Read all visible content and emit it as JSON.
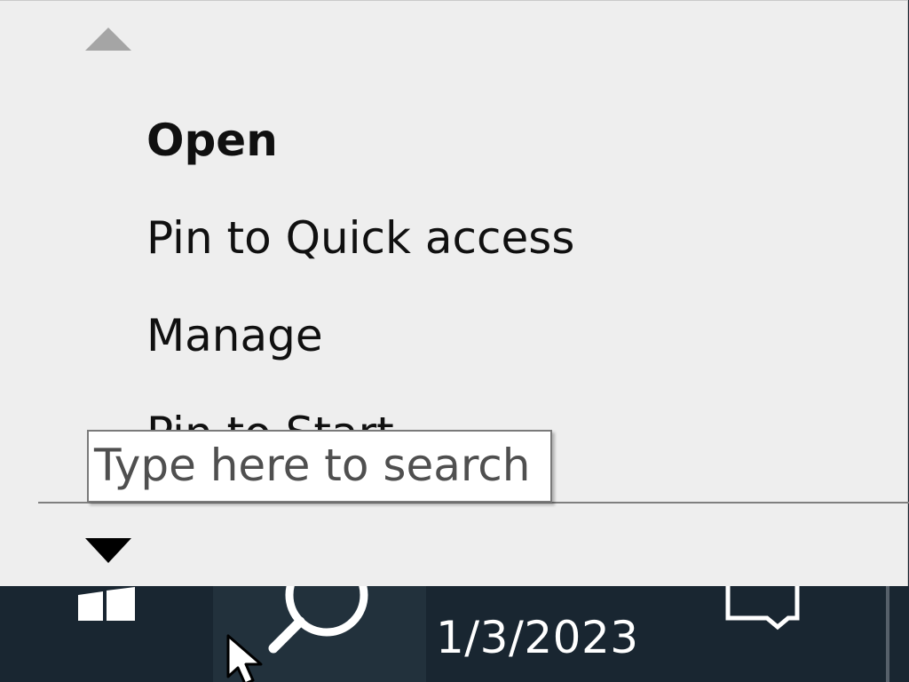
{
  "jump_list": {
    "scroll_up_icon": "triangle-up-icon",
    "scroll_down_icon": "triangle-down-icon",
    "items": [
      {
        "label": "Open",
        "bold": true
      },
      {
        "label": "Pin to Quick access",
        "bold": false
      },
      {
        "label": "Manage",
        "bold": false
      },
      {
        "label": "Pin to Start",
        "bold": false
      }
    ]
  },
  "tooltip": {
    "text": "Type here to search"
  },
  "taskbar": {
    "start_icon": "windows-logo-icon",
    "search_icon": "search-icon",
    "date": "1/3/2023",
    "action_center_icon": "notification-icon",
    "cursor_icon": "mouse-pointer-icon"
  },
  "colors": {
    "menu_background": "#eeeeee",
    "taskbar_background": "#192631",
    "search_button_background": "#22313c",
    "tooltip_border": "#7a7a7a",
    "tooltip_text": "#4f4f4f"
  }
}
